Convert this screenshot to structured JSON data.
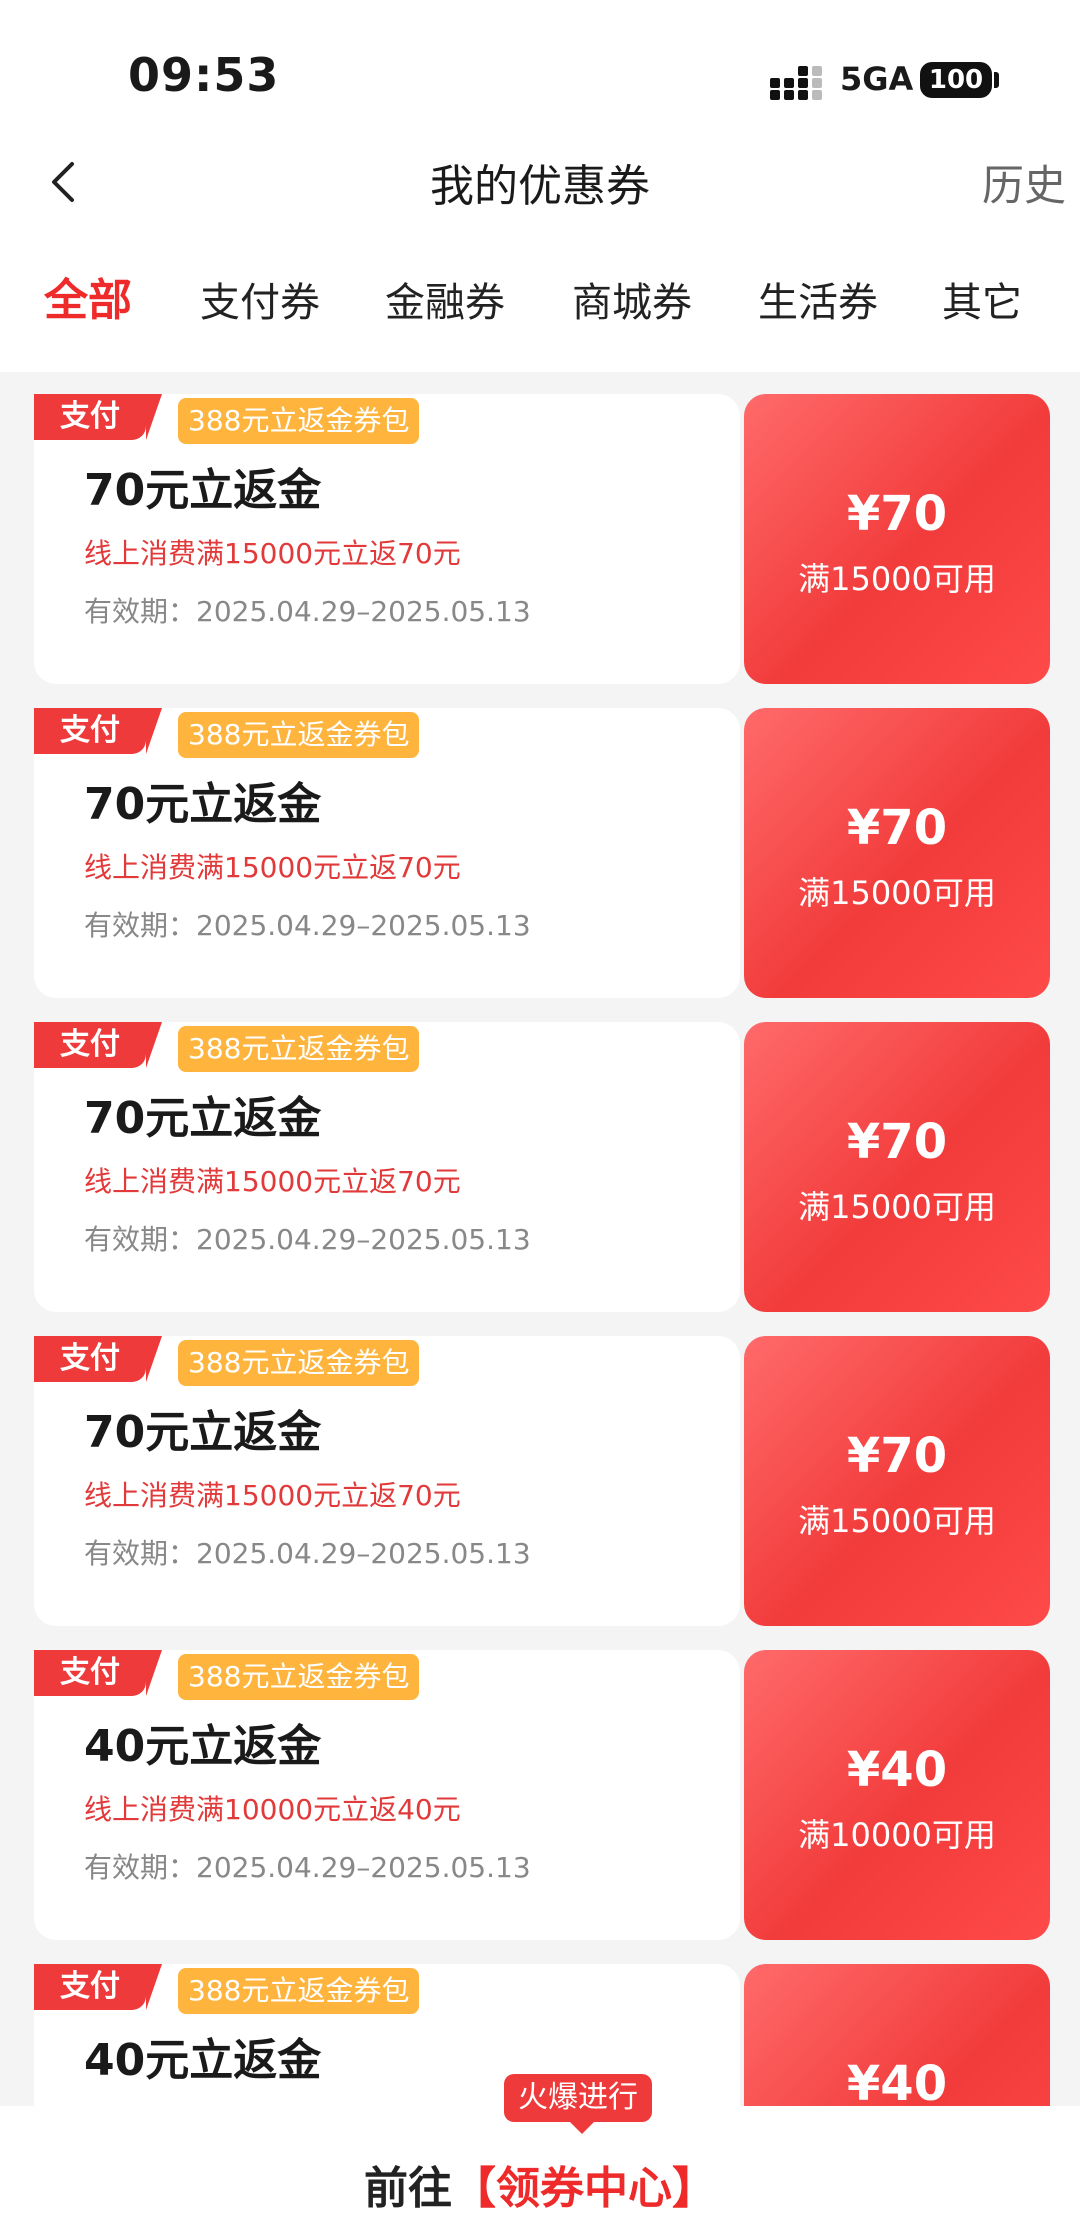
{
  "status_bar": {
    "time": "09:53",
    "network": "5GA",
    "battery": "100"
  },
  "header": {
    "title": "我的优惠券",
    "history": "历史"
  },
  "tabs": [
    {
      "label": "全部",
      "active": true
    },
    {
      "label": "支付券",
      "active": false
    },
    {
      "label": "金融券",
      "active": false
    },
    {
      "label": "商城券",
      "active": false
    },
    {
      "label": "生活券",
      "active": false
    },
    {
      "label": "其它",
      "active": false
    }
  ],
  "coupons": [
    {
      "tag": "支付",
      "pack": "388元立返金券包",
      "title": "70元立返金",
      "desc": "线上消费满15000元立返70元",
      "validity": "有效期：2025.04.29–2025.05.13",
      "amount": "¥70",
      "condition": "满15000可用"
    },
    {
      "tag": "支付",
      "pack": "388元立返金券包",
      "title": "70元立返金",
      "desc": "线上消费满15000元立返70元",
      "validity": "有效期：2025.04.29–2025.05.13",
      "amount": "¥70",
      "condition": "满15000可用"
    },
    {
      "tag": "支付",
      "pack": "388元立返金券包",
      "title": "70元立返金",
      "desc": "线上消费满15000元立返70元",
      "validity": "有效期：2025.04.29–2025.05.13",
      "amount": "¥70",
      "condition": "满15000可用"
    },
    {
      "tag": "支付",
      "pack": "388元立返金券包",
      "title": "70元立返金",
      "desc": "线上消费满15000元立返70元",
      "validity": "有效期：2025.04.29–2025.05.13",
      "amount": "¥70",
      "condition": "满15000可用"
    },
    {
      "tag": "支付",
      "pack": "388元立返金券包",
      "title": "40元立返金",
      "desc": "线上消费满10000元立返40元",
      "validity": "有效期：2025.04.29–2025.05.13",
      "amount": "¥40",
      "condition": "满10000可用"
    },
    {
      "tag": "支付",
      "pack": "388元立返金券包",
      "title": "40元立返金",
      "desc": "",
      "validity": "",
      "amount": "¥40",
      "condition": ""
    }
  ],
  "bottom": {
    "badge": "火爆进行",
    "prefix": "前往",
    "link": "【领券中心】"
  },
  "colors": {
    "accent": "#ee2a2a",
    "pack_badge": "#ffb53d",
    "background": "#f4f4f4"
  }
}
